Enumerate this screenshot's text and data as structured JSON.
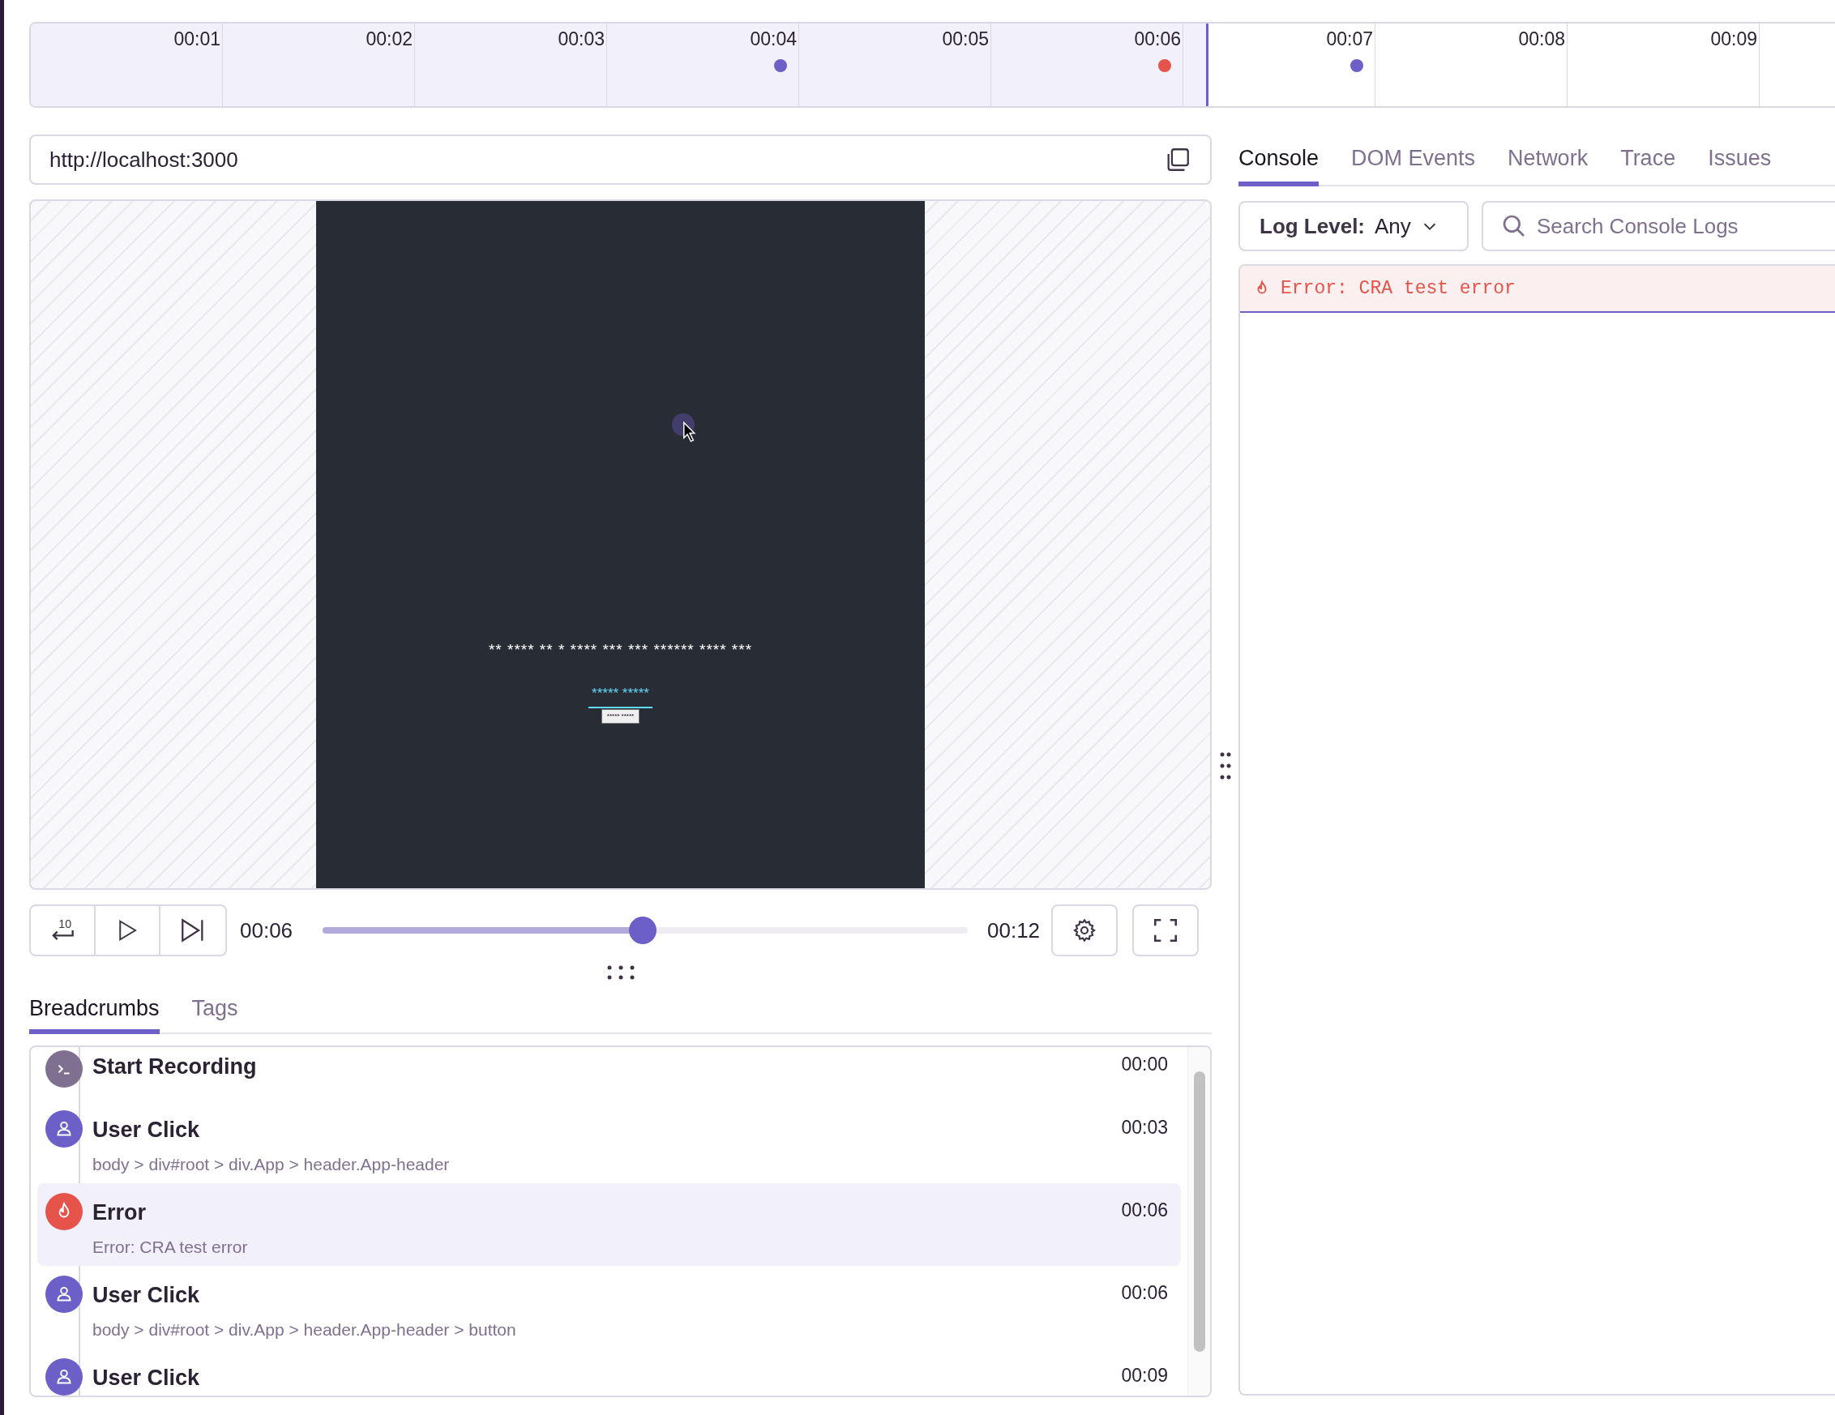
{
  "timeline": {
    "level": 0.651,
    "ticks": [
      {
        "label": "00:01"
      },
      {
        "label": "00:02"
      },
      {
        "label": "00:03"
      },
      {
        "label": "00:04",
        "markers": [
          {
            "color": "#6c5fc7"
          }
        ]
      },
      {
        "label": "00:05"
      },
      {
        "label": "00:06",
        "markers": [
          {
            "color": "#e5534b"
          }
        ]
      },
      {
        "label": "00:07",
        "markers": [
          {
            "color": "#6c5fc7"
          }
        ]
      },
      {
        "label": "00:08"
      },
      {
        "label": "00:09"
      }
    ]
  },
  "url_bar": {
    "url": "http://localhost:3000"
  },
  "replay": {
    "masked_heading": "** **** ** * **** *** *** ****** **** ***",
    "masked_link": "***** *****",
    "masked_button": "***** *****"
  },
  "controls": {
    "rewind_label": "10",
    "current_time": "00:06",
    "duration": "00:12",
    "level": 0.496
  },
  "bottom_tabs": [
    {
      "label": "Breadcrumbs",
      "selected": true
    },
    {
      "label": "Tags",
      "selected": false
    }
  ],
  "breadcrumbs": [
    {
      "kind": "start",
      "title": "Start Recording",
      "time": "00:00",
      "color": "#80708f",
      "selected": false
    },
    {
      "kind": "click",
      "title": "User Click",
      "description": "body > div#root > div.App > header.App-header",
      "time": "00:03",
      "color": "#6c5fc7",
      "selected": false
    },
    {
      "kind": "error",
      "title": "Error",
      "description": "Error: CRA test error",
      "time": "00:06",
      "color": "#e5534b",
      "selected": true
    },
    {
      "kind": "click",
      "title": "User Click",
      "description": "body > div#root > div.App > header.App-header > button",
      "time": "00:06",
      "color": "#6c5fc7",
      "selected": false
    },
    {
      "kind": "click",
      "title": "User Click",
      "time": "00:09",
      "color": "#6c5fc7",
      "selected": false
    }
  ],
  "side_tabs": [
    {
      "label": "Console",
      "selected": true
    },
    {
      "label": "DOM Events",
      "selected": false
    },
    {
      "label": "Network",
      "selected": false
    },
    {
      "label": "Trace",
      "selected": false
    },
    {
      "label": "Issues",
      "selected": false
    }
  ],
  "console": {
    "log_level_label": "Log Level:",
    "log_level_value": "Any",
    "search": {
      "placeholder": "Search Console Logs"
    },
    "logs": [
      {
        "kind": "error",
        "message": "Error: CRA test error"
      }
    ]
  }
}
